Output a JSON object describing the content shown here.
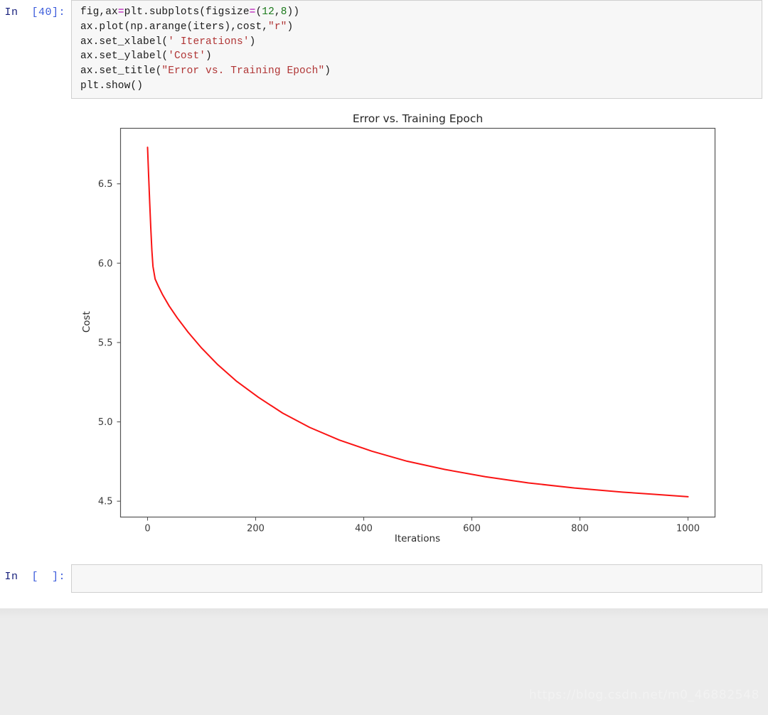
{
  "notebook": {
    "cells": [
      {
        "prompt_prefix": "In",
        "prompt_counter": "[40]:",
        "code_lines": [
          {
            "segments": [
              {
                "t": "fig,ax",
                "c": "plain"
              },
              {
                "t": "=",
                "c": "op"
              },
              {
                "t": "plt.subplots(figsize",
                "c": "plain"
              },
              {
                "t": "=",
                "c": "op"
              },
              {
                "t": "(",
                "c": "plain"
              },
              {
                "t": "12",
                "c": "num"
              },
              {
                "t": ",",
                "c": "plain"
              },
              {
                "t": "8",
                "c": "num"
              },
              {
                "t": "))",
                "c": "plain"
              }
            ]
          },
          {
            "segments": [
              {
                "t": "ax.plot(np.arange(iters),cost,",
                "c": "plain"
              },
              {
                "t": "\"r\"",
                "c": "str"
              },
              {
                "t": ")",
                "c": "plain"
              }
            ]
          },
          {
            "segments": [
              {
                "t": "ax.set_xlabel(",
                "c": "plain"
              },
              {
                "t": "' Iterations'",
                "c": "str"
              },
              {
                "t": ")",
                "c": "plain"
              }
            ]
          },
          {
            "segments": [
              {
                "t": "ax.set_ylabel(",
                "c": "plain"
              },
              {
                "t": "'Cost'",
                "c": "str"
              },
              {
                "t": ")",
                "c": "plain"
              }
            ]
          },
          {
            "segments": [
              {
                "t": "ax.set_title(",
                "c": "plain"
              },
              {
                "t": "\"Error vs. Training Epoch\"",
                "c": "str"
              },
              {
                "t": ")",
                "c": "plain"
              }
            ]
          },
          {
            "segments": [
              {
                "t": "plt.show()",
                "c": "plain"
              }
            ]
          }
        ]
      },
      {
        "prompt_prefix": "In",
        "prompt_counter": "[  ]:",
        "code_lines": []
      }
    ]
  },
  "watermark": {
    "text": "https://blog.csdn.net/m0_46882548"
  },
  "chart_data": {
    "type": "line",
    "title": "Error vs. Training Epoch",
    "xlabel": "Iterations",
    "ylabel": "Cost",
    "xlim": [
      -50,
      1050
    ],
    "ylim": [
      4.4,
      6.85
    ],
    "xticks": [
      0,
      200,
      400,
      600,
      800,
      1000
    ],
    "xticklabels": [
      "0",
      "200",
      "400",
      "600",
      "800",
      "1000"
    ],
    "yticks": [
      4.5,
      5.0,
      5.5,
      6.0,
      6.5
    ],
    "yticklabels": [
      "4.5",
      "5.0",
      "5.5",
      "6.0",
      "6.5"
    ],
    "grid": false,
    "legend": null,
    "series": [
      {
        "name": "cost",
        "color": "#fa1414",
        "linewidth": 2,
        "x": [
          0,
          2,
          4,
          6,
          8,
          10,
          14,
          20,
          28,
          40,
          55,
          75,
          100,
          130,
          165,
          205,
          250,
          300,
          355,
          415,
          480,
          550,
          625,
          705,
          790,
          880,
          940,
          1000
        ],
        "y": [
          6.73,
          6.55,
          6.38,
          6.22,
          6.08,
          5.98,
          5.9,
          5.855,
          5.8,
          5.73,
          5.655,
          5.565,
          5.465,
          5.36,
          5.255,
          5.155,
          5.055,
          4.965,
          4.885,
          4.815,
          4.752,
          4.7,
          4.654,
          4.615,
          4.583,
          4.557,
          4.543,
          4.528
        ]
      }
    ]
  }
}
